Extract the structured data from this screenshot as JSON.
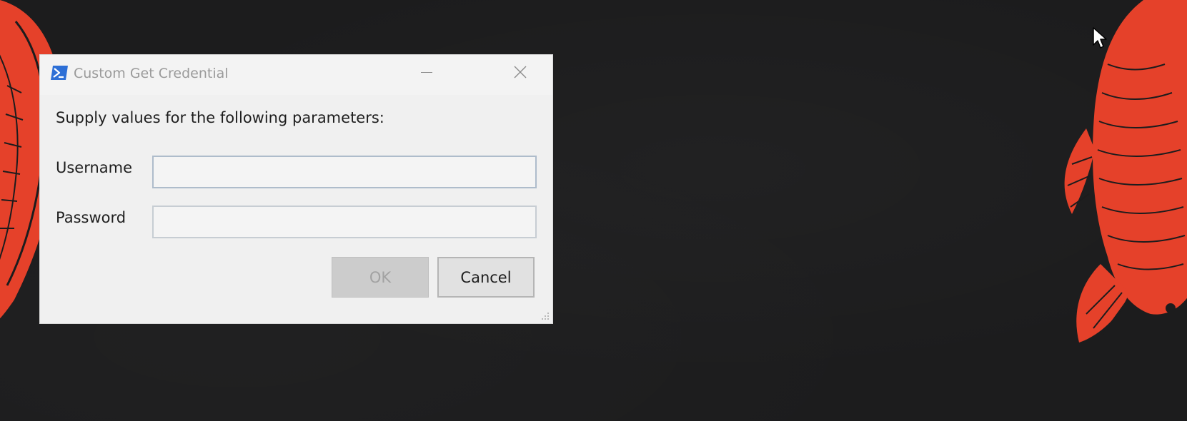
{
  "desktop": {
    "background_color": "#1c1c1d",
    "wallpaper": "koi-fish-art",
    "accent_color": "#e5412a"
  },
  "dialog": {
    "title": "Custom Get Credential",
    "app_icon": "powershell-icon",
    "minimize_icon": "minimize-icon",
    "close_icon": "close-icon",
    "prompt": "Supply values for the following parameters:",
    "fields": [
      {
        "label": "Username",
        "value": "",
        "type": "text"
      },
      {
        "label": "Password",
        "value": "",
        "type": "password"
      }
    ],
    "buttons": {
      "ok_label": "OK",
      "ok_enabled": false,
      "cancel_label": "Cancel"
    },
    "resize_grip_icon": "resize-grip-icon"
  }
}
